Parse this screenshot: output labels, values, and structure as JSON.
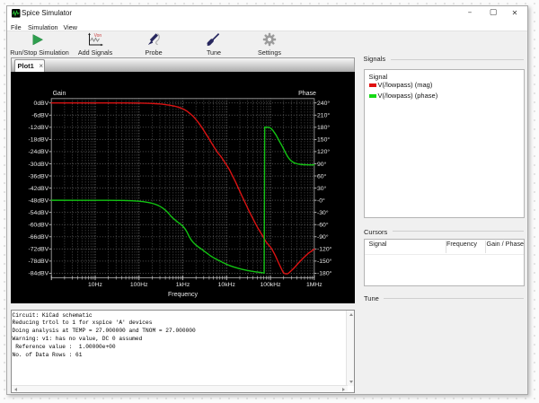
{
  "window": {
    "title": "Spice Simulator"
  },
  "window_controls": {
    "minimize": "–",
    "maximize": "▢",
    "close": "✕"
  },
  "menu": {
    "items": [
      "File",
      "Simulation",
      "View"
    ]
  },
  "toolbar": {
    "items": [
      {
        "label": "Run/Stop Simulation",
        "icon": "play-icon"
      },
      {
        "label": "Add Signals",
        "icon": "chart-icon"
      },
      {
        "label": "Probe",
        "icon": "probe-icon"
      },
      {
        "label": "Tune",
        "icon": "screwdriver-icon"
      },
      {
        "label": "Settings",
        "icon": "gear-icon"
      }
    ]
  },
  "tabs": {
    "active_label": "Plot1",
    "close_glyph": "×"
  },
  "chart_data": {
    "type": "line",
    "x_scale": "log",
    "xlabel": "Frequency",
    "ylabel_left": "Gain",
    "ylabel_right": "Phase",
    "xlim": [
      1,
      1000000
    ],
    "ylim_left_dBV": [
      -84,
      0
    ],
    "ylim_right_deg": [
      -180,
      240
    ],
    "x_ticks": [
      {
        "f": 10,
        "label": "10Hz"
      },
      {
        "f": 100,
        "label": "100Hz"
      },
      {
        "f": 1000,
        "label": "1kHz"
      },
      {
        "f": 10000,
        "label": "10kHz"
      },
      {
        "f": 100000,
        "label": "100kHz"
      },
      {
        "f": 1000000,
        "label": "1MHz"
      }
    ],
    "y_left_ticks": [
      "0dBV",
      "-6dBV",
      "-12dBV",
      "-18dBV",
      "-24dBV",
      "-30dBV",
      "-36dBV",
      "-42dBV",
      "-48dBV",
      "-54dBV",
      "-60dBV",
      "-66dBV",
      "-72dBV",
      "-78dBV",
      "-84dBV"
    ],
    "y_right_ticks": [
      "240°",
      "210°",
      "180°",
      "150°",
      "120°",
      "90°",
      "60°",
      "30°",
      "-0°",
      "-30°",
      "-60°",
      "-90°",
      "-120°",
      "-150°",
      "-180°"
    ],
    "grid": "dotted",
    "background": "#000000",
    "series": [
      {
        "name": "V(/lowpass) (mag)",
        "axis": "gain_dBV",
        "color": "#da1212",
        "points": [
          [
            1,
            0
          ],
          [
            50,
            0
          ],
          [
            100,
            -0.05
          ],
          [
            150,
            -0.15
          ],
          [
            220,
            -0.3
          ],
          [
            300,
            -0.5
          ],
          [
            400,
            -0.8
          ],
          [
            500,
            -1.1
          ],
          [
            620,
            -1.5
          ],
          [
            760,
            -2
          ],
          [
            900,
            -2.5
          ],
          [
            1050,
            -3.1
          ],
          [
            1250,
            -4.1
          ],
          [
            1450,
            -5.2
          ],
          [
            1700,
            -6.5
          ],
          [
            2000,
            -8.2
          ],
          [
            2400,
            -10.4
          ],
          [
            2900,
            -13
          ],
          [
            3400,
            -15.4
          ],
          [
            3900,
            -17.4
          ],
          [
            4600,
            -20
          ],
          [
            5400,
            -22.4
          ],
          [
            6300,
            -24.6
          ],
          [
            7400,
            -26.4
          ],
          [
            8700,
            -28.7
          ],
          [
            10000,
            -30.7
          ],
          [
            11500,
            -32.8
          ],
          [
            13500,
            -35.8
          ],
          [
            16000,
            -39
          ],
          [
            19000,
            -42.5
          ],
          [
            22500,
            -46
          ],
          [
            27000,
            -49.6
          ],
          [
            32000,
            -53
          ],
          [
            38000,
            -56.2
          ],
          [
            45000,
            -59.3
          ],
          [
            54000,
            -62.4
          ],
          [
            65000,
            -65.2
          ],
          [
            78000,
            -68.2
          ],
          [
            92000,
            -70.2
          ],
          [
            102000,
            -71.3
          ],
          [
            115000,
            -73.2
          ],
          [
            130000,
            -75.4
          ],
          [
            147000,
            -78
          ],
          [
            170000,
            -80.9
          ],
          [
            195000,
            -83.5
          ],
          [
            215000,
            -84.2
          ],
          [
            245000,
            -84.2
          ],
          [
            268000,
            -83.7
          ],
          [
            300000,
            -82.7
          ],
          [
            350000,
            -81.3
          ],
          [
            415000,
            -79.5
          ],
          [
            500000,
            -77.6
          ],
          [
            600000,
            -75.9
          ],
          [
            720000,
            -74.3
          ],
          [
            860000,
            -73.1
          ],
          [
            1000000,
            -72.1
          ]
        ]
      },
      {
        "name": "V(/lowpass) (phase)",
        "axis": "phase_deg",
        "color": "#12c212",
        "points": [
          [
            1,
            0
          ],
          [
            20,
            -0.2
          ],
          [
            40,
            -0.5
          ],
          [
            70,
            -1.2
          ],
          [
            100,
            -2.4
          ],
          [
            140,
            -4.2
          ],
          [
            200,
            -7.5
          ],
          [
            270,
            -12.5
          ],
          [
            350,
            -19.5
          ],
          [
            450,
            -29.5
          ],
          [
            555,
            -41
          ],
          [
            700,
            -50.5
          ],
          [
            860,
            -58
          ],
          [
            1000,
            -64
          ],
          [
            1130,
            -71
          ],
          [
            1260,
            -79.5
          ],
          [
            1390,
            -89
          ],
          [
            1530,
            -96.5
          ],
          [
            1700,
            -103
          ],
          [
            2000,
            -110.5
          ],
          [
            2400,
            -117
          ],
          [
            2900,
            -123.5
          ],
          [
            3500,
            -130
          ],
          [
            4300,
            -137
          ],
          [
            5200,
            -142.5
          ],
          [
            6200,
            -147
          ],
          [
            7100,
            -150
          ],
          [
            8500,
            -154.5
          ],
          [
            10000,
            -158
          ],
          [
            12000,
            -161.5
          ],
          [
            14500,
            -164.5
          ],
          [
            18000,
            -167.5
          ],
          [
            22000,
            -170
          ],
          [
            28000,
            -172.5
          ],
          [
            35000,
            -174.5
          ],
          [
            45000,
            -176.3
          ],
          [
            55000,
            -177.6
          ],
          [
            65000,
            -178.7
          ],
          [
            72000,
            -179.4
          ],
          [
            74000,
            180.4
          ],
          [
            80000,
            180.2
          ],
          [
            88000,
            180
          ],
          [
            95000,
            179.3
          ],
          [
            103000,
            177
          ],
          [
            112000,
            173
          ],
          [
            122000,
            167.5
          ],
          [
            134000,
            161
          ],
          [
            148000,
            152.5
          ],
          [
            163000,
            144
          ],
          [
            180000,
            136
          ],
          [
            200000,
            126.5
          ],
          [
            220000,
            117.5
          ],
          [
            245000,
            108.5
          ],
          [
            270000,
            102
          ],
          [
            300000,
            97
          ],
          [
            340000,
            93
          ],
          [
            390000,
            90.5
          ],
          [
            450000,
            89
          ],
          [
            530000,
            88
          ],
          [
            650000,
            87.5
          ],
          [
            800000,
            87.3
          ],
          [
            1000000,
            87.2
          ]
        ]
      }
    ]
  },
  "signals_panel": {
    "header": "Signals",
    "list_header": "Signal",
    "rows": [
      {
        "label": "V(/lowpass) (mag)",
        "color": "#e01010"
      },
      {
        "label": "V(/lowpass) (phase)",
        "color": "#16d916"
      }
    ]
  },
  "cursors_panel": {
    "header": "Cursors",
    "columns": [
      "Signal",
      "Frequency",
      "Gain / Phase"
    ]
  },
  "tune_panel": {
    "header": "Tune"
  },
  "console": {
    "lines": [
      "Circuit: KiCad schematic",
      "Reducing trtol to 1 for xspice 'A' devices",
      "Doing analysis at TEMP = 27.000000 and TNOM = 27.000000",
      "Warning: v1: has no value, DC 0 assumed",
      " Reference value :  1.00000e+00",
      "No. of Data Rows : 61"
    ]
  }
}
